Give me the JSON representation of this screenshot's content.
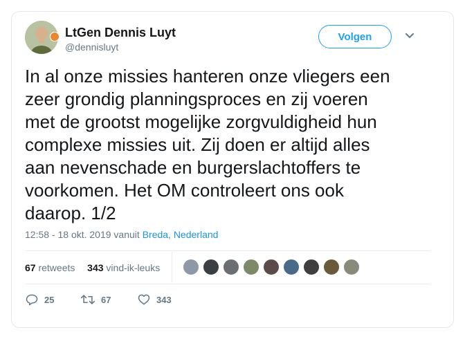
{
  "tweet": {
    "author_name": "LtGen Dennis Luyt",
    "author_handle": "@dennisluyt",
    "follow_label": "Volgen",
    "text_lines": [
      "In al onze missies hanteren onze vliegers een",
      "zeer grondig planningsproces en zij voeren",
      "met de grootst mogelijke zorgvuldigheid hun",
      "complexe missies uit. Zij doen er altijd alles",
      "aan nevenschade en burgerslachtoffers te",
      "voorkomen. Het OM controleert ons ook",
      "daarop. 1/2"
    ],
    "timestamp": "12:58 - 18 okt. 2019 vanuit",
    "location": "Breda, Nederland"
  },
  "stats": {
    "retweets_count": "67",
    "retweets_label": "retweets",
    "likes_count": "343",
    "likes_label": "vind-ik-leuks",
    "liker_colors": [
      "#8d99a6",
      "#3b3f45",
      "#6b6f73",
      "#7d8a6a",
      "#5a4a4a",
      "#4a6a8a",
      "#3f3f3f",
      "#6a5a3a",
      "#8a8a7a"
    ]
  },
  "actions": {
    "reply_count": "25",
    "retweet_count": "67",
    "like_count": "343"
  },
  "colors": {
    "accent": "#1da1f2",
    "secondary_text": "#657786",
    "primary_text": "#14171a"
  },
  "icons": {
    "verified_like_badge": "orange-badge-icon",
    "menu": "chevron-down-icon",
    "reply": "reply-icon",
    "retweet": "retweet-icon",
    "like": "heart-icon"
  }
}
